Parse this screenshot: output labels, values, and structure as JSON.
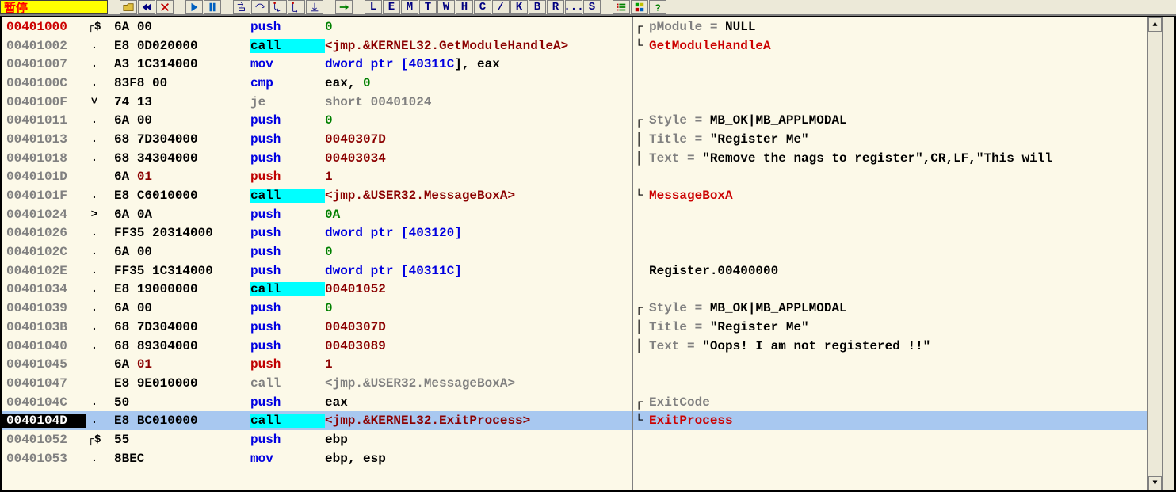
{
  "status": "暂停",
  "toolbar_letters": [
    "L",
    "E",
    "M",
    "T",
    "W",
    "H",
    "C",
    "/",
    "K",
    "B",
    "R",
    "...",
    "S"
  ],
  "rows": [
    {
      "addr": "00401000",
      "addr_cls": "entry",
      "mark": "┌$",
      "bytes_main": "6A ",
      "bytes_arg": "00",
      "mn": "push",
      "mn_cls": "blue",
      "ops": [
        {
          "t": "0",
          "cls": "op-green"
        }
      ]
    },
    {
      "addr": "00401002",
      "addr_cls": "",
      "mark": ".",
      "bytes_main": "E8 ",
      "bytes_arg": "0D020000",
      "mn": "call",
      "mn_cls": "call",
      "ops": [
        {
          "t": "<jmp.&KERNEL32.GetModuleHandleA>",
          "cls": "op-red"
        }
      ]
    },
    {
      "addr": "00401007",
      "addr_cls": "",
      "mark": ".",
      "bytes_main": "A3 ",
      "bytes_arg": "1C314000",
      "mn": "mov",
      "mn_cls": "blue",
      "ops": [
        {
          "t": "dword ptr ",
          "cls": "op-blue"
        },
        {
          "t": "[",
          "cls": "op-blue"
        },
        {
          "t": "40311C",
          "cls": "op-blue"
        },
        {
          "t": "], ",
          "cls": "op-black"
        },
        {
          "t": "eax",
          "cls": "op-black"
        }
      ]
    },
    {
      "addr": "0040100C",
      "addr_cls": "",
      "mark": ".",
      "bytes_main": "83F8 ",
      "bytes_arg": "00",
      "mn": "cmp",
      "mn_cls": "blue",
      "ops": [
        {
          "t": "eax",
          "cls": "op-black"
        },
        {
          "t": ", ",
          "cls": "op-black"
        },
        {
          "t": "0",
          "cls": "op-green"
        }
      ]
    },
    {
      "addr": "0040100F",
      "addr_cls": "",
      "mark": "˅",
      "bytes_main": "74 ",
      "bytes_arg": "13",
      "mn": "je",
      "mn_cls": "grey",
      "ops": [
        {
          "t": "short 00401024",
          "cls": "op-grey"
        }
      ]
    },
    {
      "addr": "00401011",
      "addr_cls": "",
      "mark": ".",
      "bytes_main": "6A ",
      "bytes_arg": "00",
      "mn": "push",
      "mn_cls": "blue",
      "ops": [
        {
          "t": "0",
          "cls": "op-green"
        }
      ]
    },
    {
      "addr": "00401013",
      "addr_cls": "",
      "mark": ".",
      "bytes_main": "68 ",
      "bytes_arg": "7D304000",
      "mn": "push",
      "mn_cls": "blue",
      "ops": [
        {
          "t": "0040307D",
          "cls": "op-red"
        }
      ]
    },
    {
      "addr": "00401018",
      "addr_cls": "",
      "mark": ".",
      "bytes_main": "68 ",
      "bytes_arg": "34304000",
      "mn": "push",
      "mn_cls": "blue",
      "ops": [
        {
          "t": "00403034",
          "cls": "op-red"
        }
      ]
    },
    {
      "addr": "0040101D",
      "addr_cls": "",
      "mark": "",
      "bytes_main": "6A ",
      "bytes_arg": "01",
      "arg_red": true,
      "mn": "push",
      "mn_cls": "red",
      "ops": [
        {
          "t": "1",
          "cls": "op-red"
        }
      ]
    },
    {
      "addr": "0040101F",
      "addr_cls": "",
      "mark": ".",
      "bytes_main": "E8 ",
      "bytes_arg": "C6010000",
      "mn": "call",
      "mn_cls": "call",
      "ops": [
        {
          "t": "<jmp.&USER32.MessageBoxA>",
          "cls": "op-red"
        }
      ]
    },
    {
      "addr": "00401024",
      "addr_cls": "",
      "mark": ">",
      "bytes_main": "6A ",
      "bytes_arg": "0A",
      "mn": "push",
      "mn_cls": "blue",
      "ops": [
        {
          "t": "0A",
          "cls": "op-green"
        }
      ]
    },
    {
      "addr": "00401026",
      "addr_cls": "",
      "mark": ".",
      "bytes_main": "FF35 ",
      "bytes_arg": "20314000",
      "mn": "push",
      "mn_cls": "blue",
      "ops": [
        {
          "t": "dword ptr ",
          "cls": "op-blue"
        },
        {
          "t": "[",
          "cls": "op-blue"
        },
        {
          "t": "403120",
          "cls": "op-blue"
        },
        {
          "t": "]",
          "cls": "op-blue"
        }
      ]
    },
    {
      "addr": "0040102C",
      "addr_cls": "",
      "mark": ".",
      "bytes_main": "6A ",
      "bytes_arg": "00",
      "mn": "push",
      "mn_cls": "blue",
      "ops": [
        {
          "t": "0",
          "cls": "op-green"
        }
      ]
    },
    {
      "addr": "0040102E",
      "addr_cls": "",
      "mark": ".",
      "bytes_main": "FF35 ",
      "bytes_arg": "1C314000",
      "mn": "push",
      "mn_cls": "blue",
      "ops": [
        {
          "t": "dword ptr ",
          "cls": "op-blue"
        },
        {
          "t": "[",
          "cls": "op-blue"
        },
        {
          "t": "40311C",
          "cls": "op-blue"
        },
        {
          "t": "]",
          "cls": "op-blue"
        }
      ]
    },
    {
      "addr": "00401034",
      "addr_cls": "",
      "mark": ".",
      "bytes_main": "E8 ",
      "bytes_arg": "19000000",
      "mn": "call",
      "mn_cls": "call",
      "ops": [
        {
          "t": "00401052",
          "cls": "op-red"
        }
      ]
    },
    {
      "addr": "00401039",
      "addr_cls": "",
      "mark": ".",
      "bytes_main": "6A ",
      "bytes_arg": "00",
      "mn": "push",
      "mn_cls": "blue",
      "ops": [
        {
          "t": "0",
          "cls": "op-green"
        }
      ]
    },
    {
      "addr": "0040103B",
      "addr_cls": "",
      "mark": ".",
      "bytes_main": "68 ",
      "bytes_arg": "7D304000",
      "mn": "push",
      "mn_cls": "blue",
      "ops": [
        {
          "t": "0040307D",
          "cls": "op-red"
        }
      ]
    },
    {
      "addr": "00401040",
      "addr_cls": "",
      "mark": ".",
      "bytes_main": "68 ",
      "bytes_arg": "89304000",
      "mn": "push",
      "mn_cls": "blue",
      "ops": [
        {
          "t": "00403089",
          "cls": "op-red"
        }
      ]
    },
    {
      "addr": "00401045",
      "addr_cls": "",
      "mark": "",
      "bytes_main": "6A ",
      "bytes_arg": "01",
      "arg_red": true,
      "mn": "push",
      "mn_cls": "red",
      "ops": [
        {
          "t": "1",
          "cls": "op-red"
        }
      ]
    },
    {
      "addr": "00401047",
      "addr_cls": "",
      "mark": "",
      "bytes_main": "E8 ",
      "bytes_arg": "9E010000",
      "mn": "call",
      "mn_cls": "callgrey",
      "ops": [
        {
          "t": "<jmp.&USER32.MessageBoxA>",
          "cls": "op-grey"
        }
      ]
    },
    {
      "addr": "0040104C",
      "addr_cls": "",
      "mark": ".",
      "bytes_main": "50",
      "bytes_arg": "",
      "mn": "push",
      "mn_cls": "blue",
      "ops": [
        {
          "t": "eax",
          "cls": "op-black"
        }
      ]
    },
    {
      "addr": "0040104D",
      "addr_cls": "selinv",
      "sel": true,
      "mark": ".",
      "bytes_main": "E8 ",
      "bytes_arg": "BC010000",
      "mn": "call",
      "mn_cls": "call",
      "ops": [
        {
          "t": "<jmp.&KERNEL32.ExitProcess>",
          "cls": "op-red"
        }
      ]
    },
    {
      "addr": "00401052",
      "addr_cls": "",
      "mark": "┌$",
      "bytes_main": "55",
      "bytes_arg": "",
      "mn": "push",
      "mn_cls": "blue",
      "ops": [
        {
          "t": "ebp",
          "cls": "op-black"
        }
      ]
    },
    {
      "addr": "00401053",
      "addr_cls": "",
      "mark": ".",
      "bytes_main": "8BEC",
      "bytes_arg": "",
      "mn": "mov",
      "mn_cls": "blue",
      "ops": [
        {
          "t": "ebp",
          "cls": "op-black"
        },
        {
          "t": ", ",
          "cls": "op-black"
        },
        {
          "t": "esp",
          "cls": "op-black"
        }
      ]
    }
  ],
  "comments": [
    {
      "bracket": "┌",
      "spans": [
        {
          "t": "pModule",
          "cls": "c-grey"
        },
        {
          "t": " = ",
          "cls": "c-grey"
        },
        {
          "t": "NULL",
          "cls": "c-black"
        }
      ]
    },
    {
      "bracket": "└",
      "spans": [
        {
          "t": "GetModuleHandleA",
          "cls": "c-red"
        }
      ]
    },
    {
      "bracket": "",
      "spans": []
    },
    {
      "bracket": "",
      "spans": []
    },
    {
      "bracket": "",
      "spans": []
    },
    {
      "bracket": "┌",
      "spans": [
        {
          "t": "Style",
          "cls": "c-grey"
        },
        {
          "t": " = ",
          "cls": "c-grey"
        },
        {
          "t": "MB_OK|MB_APPLMODAL",
          "cls": "c-black"
        }
      ]
    },
    {
      "bracket": "│",
      "spans": [
        {
          "t": "Title",
          "cls": "c-grey"
        },
        {
          "t": " = ",
          "cls": "c-grey"
        },
        {
          "t": "\"Register Me\"",
          "cls": "c-black"
        }
      ]
    },
    {
      "bracket": "│",
      "spans": [
        {
          "t": "Text",
          "cls": "c-grey"
        },
        {
          "t": " = ",
          "cls": "c-grey"
        },
        {
          "t": "\"Remove the nags to register\",CR,LF,\"This will",
          "cls": "c-black"
        }
      ]
    },
    {
      "bracket": "",
      "spans": []
    },
    {
      "bracket": "└",
      "spans": [
        {
          "t": "MessageBoxA",
          "cls": "c-red"
        }
      ]
    },
    {
      "bracket": "",
      "spans": []
    },
    {
      "bracket": "",
      "spans": []
    },
    {
      "bracket": "",
      "spans": []
    },
    {
      "bracket": " ",
      "spans": [
        {
          "t": "Register.00400000",
          "cls": "c-black"
        }
      ]
    },
    {
      "bracket": "",
      "spans": []
    },
    {
      "bracket": "┌",
      "spans": [
        {
          "t": "Style",
          "cls": "c-grey"
        },
        {
          "t": " = ",
          "cls": "c-grey"
        },
        {
          "t": "MB_OK|MB_APPLMODAL",
          "cls": "c-black"
        }
      ]
    },
    {
      "bracket": "│",
      "spans": [
        {
          "t": "Title",
          "cls": "c-grey"
        },
        {
          "t": " = ",
          "cls": "c-grey"
        },
        {
          "t": "\"Register Me\"",
          "cls": "c-black"
        }
      ]
    },
    {
      "bracket": "│",
      "spans": [
        {
          "t": "Text",
          "cls": "c-grey"
        },
        {
          "t": " = ",
          "cls": "c-grey"
        },
        {
          "t": "\"Oops! I am not registered !!\"",
          "cls": "c-black"
        }
      ]
    },
    {
      "bracket": "",
      "spans": []
    },
    {
      "bracket": "",
      "spans": []
    },
    {
      "bracket": "┌",
      "spans": [
        {
          "t": "ExitCode",
          "cls": "c-grey"
        }
      ]
    },
    {
      "sel": true,
      "bracket": "└",
      "spans": [
        {
          "t": "ExitProcess",
          "cls": "c-red"
        }
      ]
    },
    {
      "bracket": "",
      "spans": []
    },
    {
      "bracket": "",
      "spans": []
    }
  ]
}
